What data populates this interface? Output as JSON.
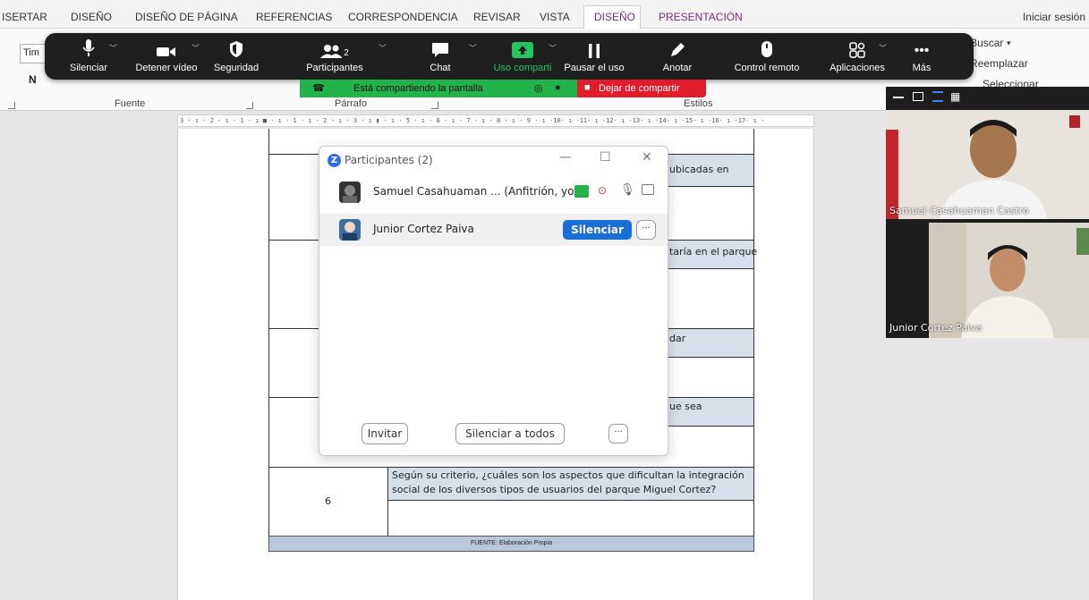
{
  "ribbon": {
    "tabs": [
      "ISERTAR",
      "DISEÑO",
      "DISEÑO DE PÁGINA",
      "REFERENCIAS",
      "CORRESPONDENCIA",
      "REVISAR",
      "VISTA",
      "DISEÑO",
      "PRESENTACIÓN"
    ],
    "login": "Iniciar sesión",
    "font_name": "Tim",
    "bold": "N",
    "group_fuente": "Fuente",
    "group_parrafo": "Párrafo",
    "group_estilos": "Estilos",
    "buscar": "Buscar",
    "reemplazar": "Reemplazar",
    "seleccionar": "Seleccionar"
  },
  "zoom_toolbar": {
    "mute": "Silenciar",
    "stop_video": "Detener vídeo",
    "security": "Seguridad",
    "participants": "Participantes",
    "participants_count": "2",
    "chat": "Chat",
    "share": "Uso comparti",
    "pause_share": "Pausar el uso",
    "annotate": "Anotar",
    "remote_control": "Control remoto",
    "apps": "Aplicaciones",
    "more": "Más",
    "sharing_banner": "Está compartiendo la pantalla",
    "stop_sharing": "Dejar de compartir"
  },
  "participants_panel": {
    "title": "Participantes (2)",
    "host_name": "Samuel Casahuaman ... (Anfitrión, yo)",
    "participant_name": "Junior Cortez Paiva",
    "mute_button": "Silenciar",
    "invite": "Invitar",
    "mute_all": "Silenciar a todos",
    "more": "···"
  },
  "video_panel": {
    "tile1_name": "Samuel Casahuaman Castro",
    "tile2_name": "Junior Cortez Paiva"
  },
  "document": {
    "row1_text": "ubicadas en",
    "row2_text": "taría en el parque",
    "row3_text": "dar",
    "row4_text": "ue sea",
    "question6": "Según su criterio, ¿cuáles son los aspectos que dificultan la integración social de los diversos tipos de usuarios del parque Miguel Cortez?",
    "row6_number": "6",
    "footer": "FUENTE: Elaboración Propia"
  },
  "ruler_text": "3 · ı · 2 · ı · 1 · ı ■ · ı · 1 · ı · 2 · ı · 3 · ı ▮ · ı · 5 · ı · 6 · ı · 7 · ı · 8 · ı · 9 · ı ·10· ı ·11· ı ·12· ı ·13· ı ·14· ı ·15· ı ·16· ı ·17· ı ·"
}
